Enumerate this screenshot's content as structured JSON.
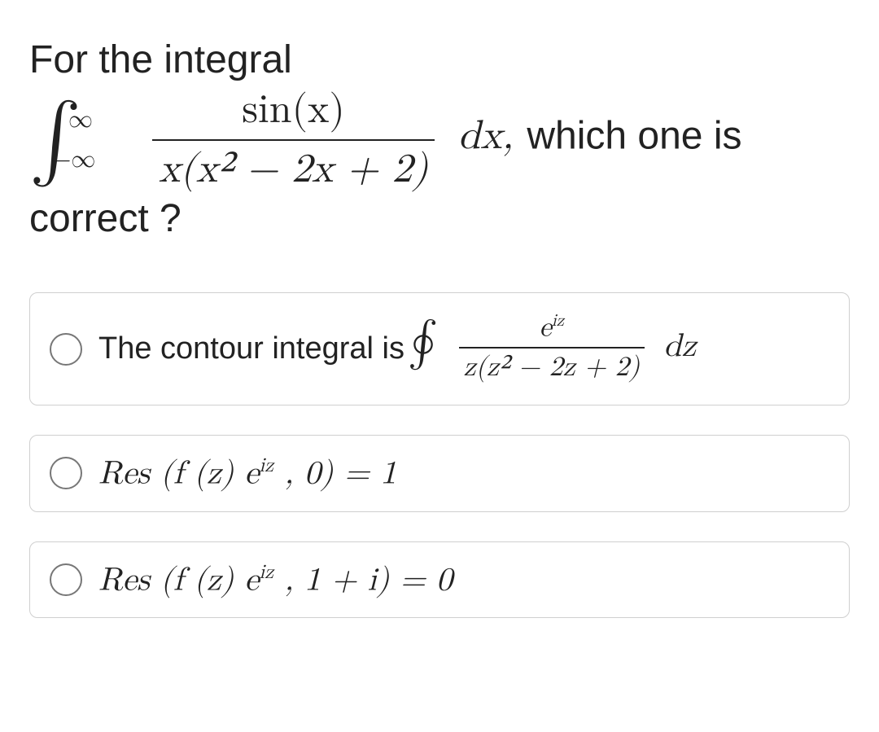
{
  "question": {
    "prefix_text": "For the integral",
    "integral": {
      "lower": "−∞",
      "upper": "∞",
      "numerator": "sin(x)",
      "denominator": "x(x² − 2x + 2)",
      "dx": "dx,"
    },
    "suffix_text_1": " which one is",
    "suffix_text_2": "correct ?"
  },
  "options": [
    {
      "id": "option-contour-integral",
      "leading_text": "The contour integral is ",
      "contour_symbol": "∮",
      "frac_num": "eⁱᶻ",
      "frac_den": "z(z² − 2z + 2)",
      "trailing": "dz"
    },
    {
      "id": "option-residue-at-0",
      "formula": "Res (f (z) eⁱᶻ , 0) = 1"
    },
    {
      "id": "option-residue-at-1plusi",
      "formula": "Res (f (z) eⁱᶻ , 1 + i) = 0"
    }
  ]
}
